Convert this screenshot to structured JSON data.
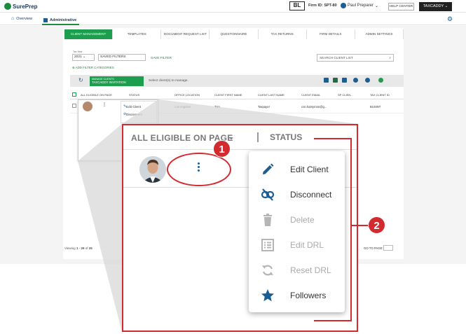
{
  "topbar": {
    "logo_text": "SurePrep",
    "firm_badge": "BL",
    "firm_label": "Firm ID:",
    "firm_id": "SPT-80",
    "user_name": "Paul Preparer",
    "help_label": "HELP CENTER",
    "taxcaddy_label": "TAXCADDY"
  },
  "nav": {
    "overview": "Overview",
    "administrative": "Administrative"
  },
  "tabs": [
    "CLIENT MANAGEMENT",
    "TEMPLATES",
    "DOCUMENT REQUEST LIST",
    "QUESTIONNAIRE",
    "TAX RETURNS",
    "FIRM DETAILS",
    "ADMIN SETTINGS"
  ],
  "filters": {
    "tax_year_label": "Tax Year",
    "tax_year": "2021",
    "saved_filters": "SAVED FILTERS",
    "save_filter": "SAVE FILTER",
    "search_placeholder": "SEARCH CLIENT LIST",
    "add_filter": "ADD FILTER CATEGORIES"
  },
  "toolbar": {
    "manage_line1": "MANAGE CLIENTS",
    "manage_line2": "TAXCADDY INVITATION",
    "select_msg": "Select client(s) to manage."
  },
  "table": {
    "headers": [
      "ALL ELIGIBLE ON PAGE",
      "STATUS",
      "OFFICE LOCATION",
      "CLIENT FIRST NAME",
      "CLIENT LAST NAME",
      "CLIENT EMAIL",
      "SP CLIEN...",
      "TAX CLIENT ID"
    ],
    "row": {
      "office": "Los Angeles",
      "first": "Tom",
      "last": "Taxpayer",
      "email": "con.harsymon@g...",
      "taxid": "BUSINT"
    }
  },
  "small_menu": [
    "Edit Client",
    "Disconnect"
  ],
  "pager": {
    "text_prefix": "Viewing",
    "range": "1 - 26",
    "of": "of",
    "total": "26",
    "goto": "GO TO PAGE:"
  },
  "zoom": {
    "header_all": "ALL ELIGIBLE ON PAGE",
    "header_status": "STATUS",
    "menu": [
      {
        "label": "Edit Client",
        "icon": "pencil-icon",
        "enabled": true
      },
      {
        "label": "Disconnect",
        "icon": "unlink-icon",
        "enabled": true
      },
      {
        "label": "Delete",
        "icon": "trash-icon",
        "enabled": false
      },
      {
        "label": "Edit DRL",
        "icon": "list-icon",
        "enabled": false
      },
      {
        "label": "Reset DRL",
        "icon": "refresh-icon",
        "enabled": false
      },
      {
        "label": "Followers",
        "icon": "star-icon",
        "enabled": true
      }
    ],
    "badge1": "1",
    "badge2": "2"
  },
  "colors": {
    "brand_green": "#1d9d4e",
    "brand_blue": "#1b5e94",
    "annotation_red": "#d22a2f"
  }
}
